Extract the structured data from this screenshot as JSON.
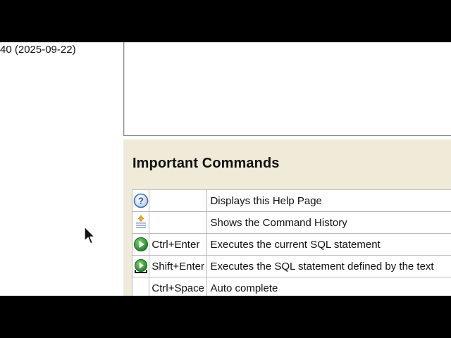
{
  "status": {
    "version_text": "40 (2025-09-22)"
  },
  "help": {
    "heading": "Important Commands",
    "commands": [
      {
        "icon": "help-icon",
        "key": "",
        "description": "Displays this Help Page"
      },
      {
        "icon": "history-icon",
        "key": "",
        "description": "Shows the Command History"
      },
      {
        "icon": "run-icon",
        "key": "Ctrl+Enter",
        "description": "Executes the current SQL statement"
      },
      {
        "icon": "run-selected-icon",
        "key": "Shift+Enter",
        "description": "Executes the SQL statement defined by the text"
      },
      {
        "icon": "",
        "key": "Ctrl+Space",
        "description": "Auto complete"
      }
    ]
  },
  "colors": {
    "panel_bg": "#efebd8",
    "run_green": "#2e9a3a",
    "help_blue": "#3a6fb0"
  }
}
